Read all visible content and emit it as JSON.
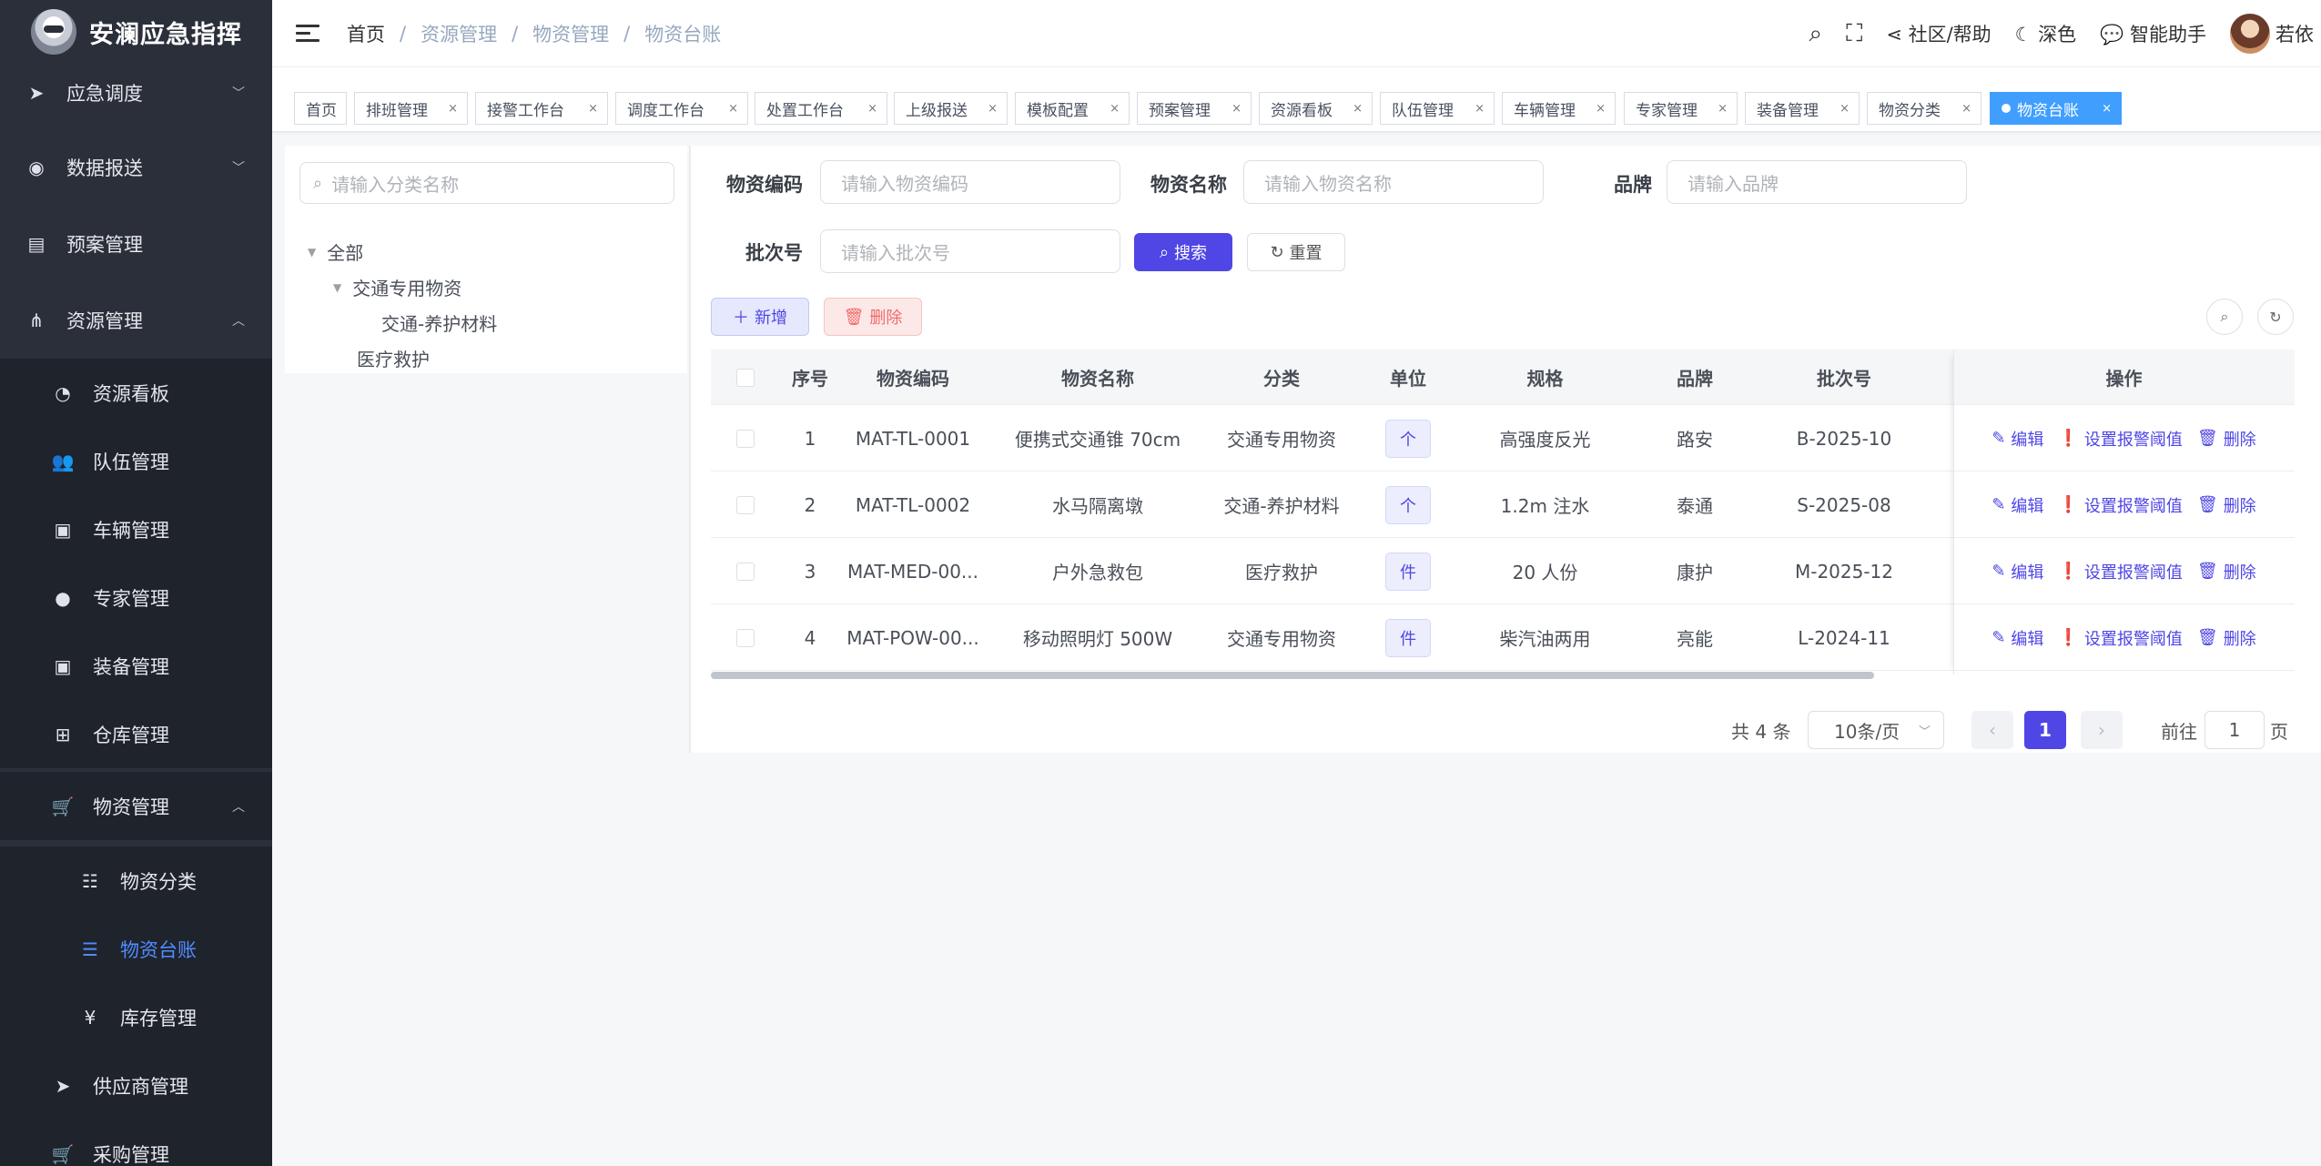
{
  "app": {
    "title": "安澜应急指挥"
  },
  "sidebar": {
    "items": [
      {
        "label": "应急调度",
        "icon": "send-icon"
      },
      {
        "label": "数据报送",
        "icon": "globe-icon"
      },
      {
        "label": "预案管理",
        "icon": "document-icon"
      },
      {
        "label": "资源管理",
        "icon": "sitemap-icon"
      },
      {
        "label": "资源看板",
        "icon": "dashboard-icon"
      },
      {
        "label": "队伍管理",
        "icon": "team-icon"
      },
      {
        "label": "车辆管理",
        "icon": "briefcase-icon"
      },
      {
        "label": "专家管理",
        "icon": "user-icon"
      },
      {
        "label": "装备管理",
        "icon": "briefcase-icon"
      },
      {
        "label": "仓库管理",
        "icon": "grid-icon"
      },
      {
        "label": "物资管理",
        "icon": "cart-icon"
      },
      {
        "label": "物资分类",
        "icon": "tree-list-icon"
      },
      {
        "label": "物资台账",
        "icon": "list-icon"
      },
      {
        "label": "库存管理",
        "icon": "yen-icon"
      },
      {
        "label": "供应商管理",
        "icon": "send-icon"
      },
      {
        "label": "采购管理",
        "icon": "cart-icon"
      }
    ]
  },
  "header": {
    "breadcrumb": [
      "首页",
      "/",
      "资源管理",
      "/",
      "物资管理",
      "/",
      "物资台账"
    ],
    "community": "社区/帮助",
    "theme": "深色",
    "assistant": "智能助手",
    "username": "若依"
  },
  "tabs": [
    {
      "label": "首页"
    },
    {
      "label": "排班管理"
    },
    {
      "label": "接警工作台"
    },
    {
      "label": "调度工作台"
    },
    {
      "label": "处置工作台"
    },
    {
      "label": "上级报送"
    },
    {
      "label": "模板配置"
    },
    {
      "label": "预案管理"
    },
    {
      "label": "资源看板"
    },
    {
      "label": "队伍管理"
    },
    {
      "label": "车辆管理"
    },
    {
      "label": "专家管理"
    },
    {
      "label": "装备管理"
    },
    {
      "label": "物资分类"
    },
    {
      "label": "物资台账"
    }
  ],
  "tree": {
    "search_placeholder": "请输入分类名称",
    "nodes": [
      "全部",
      "交通专用物资",
      "交通-养护材料",
      "医疗救护"
    ]
  },
  "filters": {
    "code_label": "物资编码",
    "code_placeholder": "请输入物资编码",
    "name_label": "物资名称",
    "name_placeholder": "请输入物资名称",
    "brand_label": "品牌",
    "brand_placeholder": "请输入品牌",
    "batch_label": "批次号",
    "batch_placeholder": "请输入批次号",
    "search_btn": "搜索",
    "reset_btn": "重置"
  },
  "toolbar": {
    "add": "新增",
    "delete": "删除"
  },
  "table": {
    "headers": [
      "序号",
      "物资编码",
      "物资名称",
      "分类",
      "单位",
      "规格",
      "品牌",
      "批次号",
      "操作"
    ],
    "rows": [
      {
        "no": "1",
        "code": "MAT-TL-0001",
        "name": "便携式交通锥 70cm",
        "category": "交通专用物资",
        "unit": "个",
        "spec": "高强度反光",
        "brand": "路安",
        "batch": "B-2025-10"
      },
      {
        "no": "2",
        "code": "MAT-TL-0002",
        "name": "水马隔离墩",
        "category": "交通-养护材料",
        "unit": "个",
        "spec": "1.2m 注水",
        "brand": "泰通",
        "batch": "S-2025-08"
      },
      {
        "no": "3",
        "code": "MAT-MED-00...",
        "name": "户外急救包",
        "category": "医疗救护",
        "unit": "件",
        "spec": "20 人份",
        "brand": "康护",
        "batch": "M-2025-12"
      },
      {
        "no": "4",
        "code": "MAT-POW-00...",
        "name": "移动照明灯 500W",
        "category": "交通专用物资",
        "unit": "件",
        "spec": "柴汽油两用",
        "brand": "亮能",
        "batch": "L-2024-11"
      }
    ],
    "ops": {
      "edit": "编辑",
      "threshold": "设置报警阈值",
      "delete": "删除"
    }
  },
  "pagination": {
    "total": "共 4 条",
    "page_size": "10条/页",
    "current": "1",
    "goto_label": "前往",
    "goto_value": "1",
    "page_suffix": "页"
  }
}
